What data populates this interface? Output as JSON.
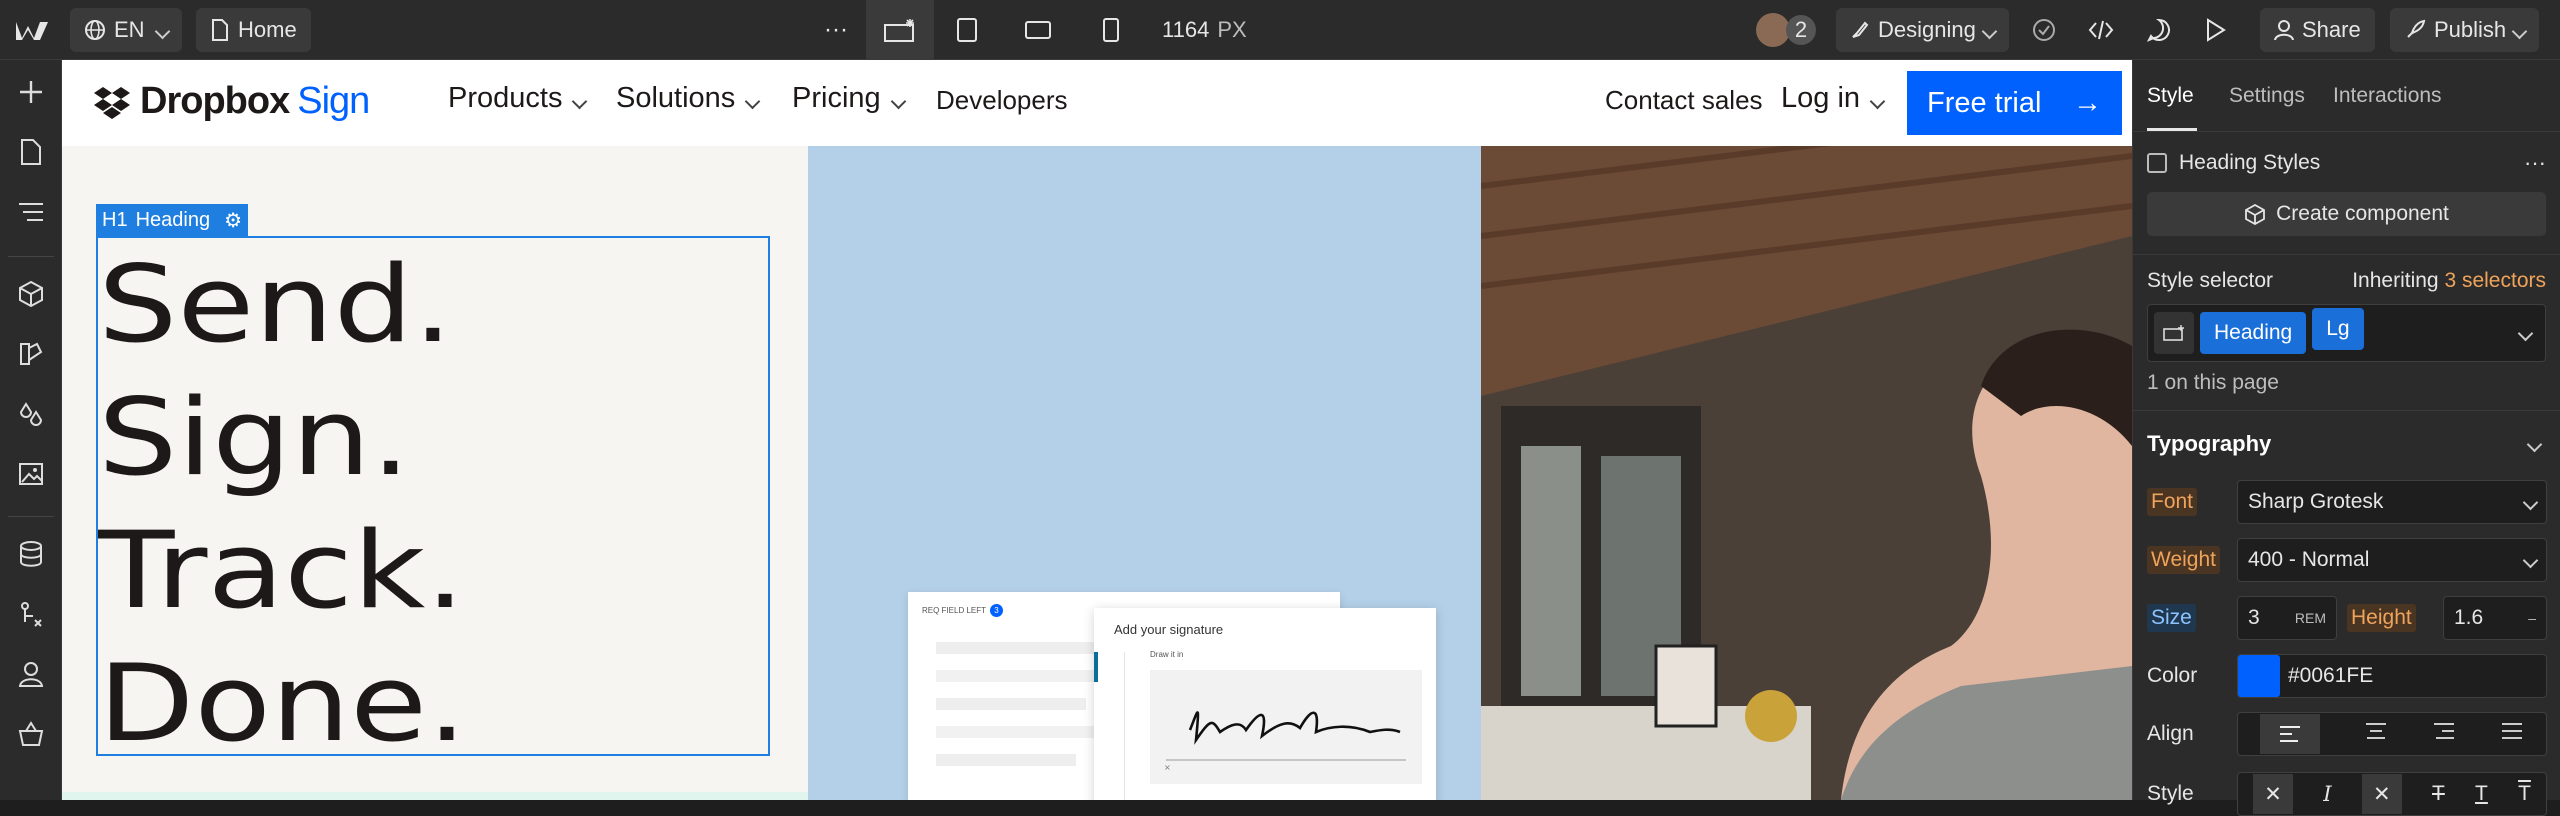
{
  "topbar": {
    "locale": "EN",
    "page": "Home",
    "width_value": "1164",
    "width_unit": "PX",
    "collaborators": "2",
    "mode": "Designing",
    "share": "Share",
    "publish": "Publish"
  },
  "site_nav": {
    "brand_a": "Dropbox",
    "brand_b": "Sign",
    "items": [
      "Products",
      "Solutions",
      "Pricing",
      "Developers"
    ],
    "contact": "Contact sales",
    "login": "Log in",
    "cta": "Free trial"
  },
  "hero": {
    "tag_level": "H1",
    "tag_label": "Heading",
    "lines": [
      "Send.",
      "Sign.",
      "Track.",
      "Done."
    ],
    "card_title": "Add your signature",
    "card_sub": "Draw it in",
    "card_badge": "REQ FIELD LEFT",
    "card_badge_count": "3"
  },
  "panel": {
    "tabs": [
      "Style",
      "Settings",
      "Interactions"
    ],
    "heading_styles": "Heading Styles",
    "create_component": "Create component",
    "style_selector": "Style selector",
    "inheriting_a": "Inheriting",
    "inheriting_b": "3 selectors",
    "chips": [
      "Heading",
      "Lg"
    ],
    "on_page": "1 on this page",
    "typography": "Typography",
    "font_label": "Font",
    "font_value": "Sharp Grotesk",
    "weight_label": "Weight",
    "weight_value": "400 - Normal",
    "size_label": "Size",
    "size_value": "3",
    "size_unit": "REM",
    "height_label": "Height",
    "height_value": "1.6",
    "height_unit": "–",
    "color_label": "Color",
    "color_value": "#0061FE",
    "align_label": "Align",
    "style_label": "Style"
  },
  "colors": {
    "accent": "#0061FE",
    "selection": "#1f7fe0"
  }
}
